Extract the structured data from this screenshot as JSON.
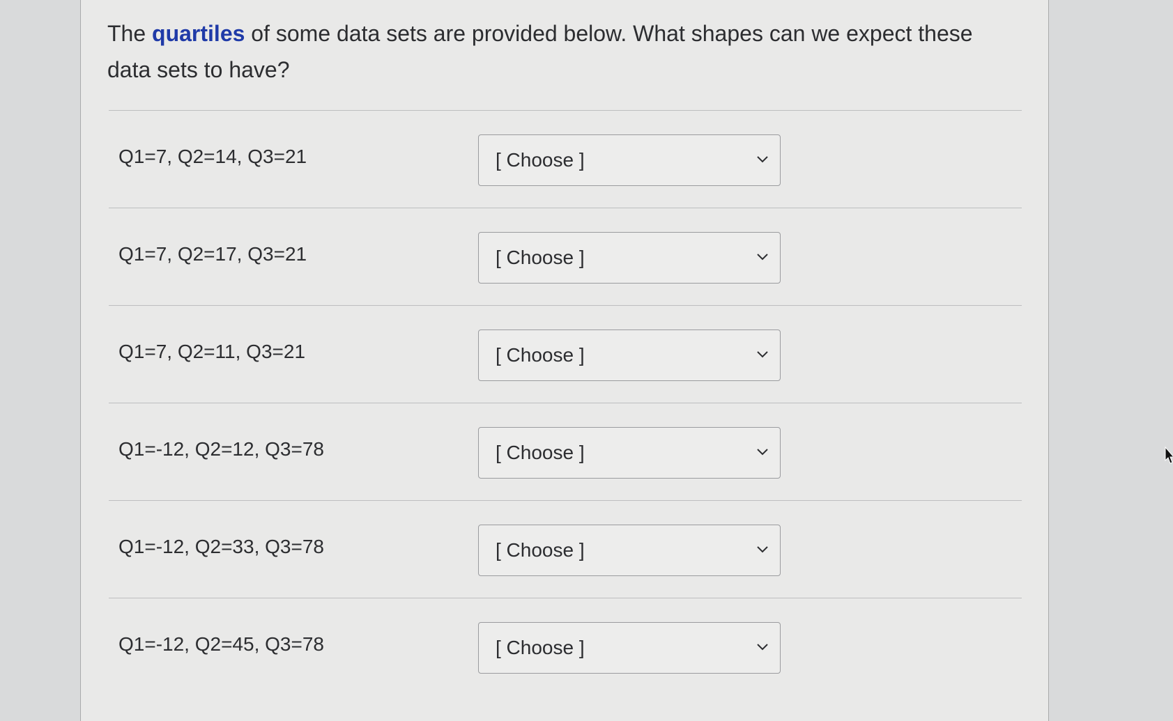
{
  "question": {
    "text_before": "The ",
    "term": "quartiles",
    "text_after": " of some data sets are provided below.  What shapes can we expect these data sets to have?"
  },
  "rows": [
    {
      "label": "Q1=7, Q2=14, Q3=21",
      "select_value": "[ Choose ]"
    },
    {
      "label": "Q1=7, Q2=17, Q3=21",
      "select_value": "[ Choose ]"
    },
    {
      "label": "Q1=7, Q2=11, Q3=21",
      "select_value": "[ Choose ]"
    },
    {
      "label": "Q1=-12, Q2=12, Q3=78",
      "select_value": "[ Choose ]"
    },
    {
      "label": "Q1=-12, Q2=33, Q3=78",
      "select_value": "[ Choose ]"
    },
    {
      "label": "Q1=-12, Q2=45, Q3=78",
      "select_value": "[ Choose ]"
    }
  ],
  "icons": {
    "dropdown": "chevron-down-icon",
    "pointer": "mouse-cursor-icon"
  },
  "colors": {
    "term_link": "#1f3aa8",
    "text": "#2c2d30",
    "panel_background": "#e9e9e8"
  }
}
